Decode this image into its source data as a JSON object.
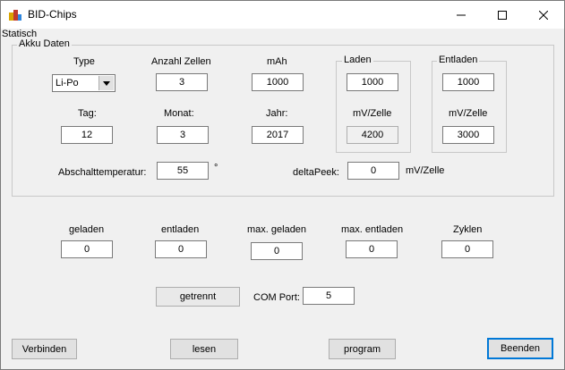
{
  "window": {
    "title": "BID-Chips"
  },
  "menu": {
    "static_label": "Statisch"
  },
  "akku": {
    "group_title": "Akku Daten",
    "type_label": "Type",
    "type_value": "Li-Po",
    "zellen_label": "Anzahl Zellen",
    "zellen_value": "3",
    "mah_label": "mAh",
    "mah_value": "1000",
    "tag_label": "Tag:",
    "tag_value": "12",
    "monat_label": "Monat:",
    "monat_value": "3",
    "jahr_label": "Jahr:",
    "jahr_value": "2017",
    "laden": {
      "group_title": "Laden",
      "value": "1000",
      "mv_label": "mV/Zelle",
      "mv_value": "4200"
    },
    "entladen": {
      "group_title": "Entladen",
      "value": "1000",
      "mv_label": "mV/Zelle",
      "mv_value": "3000"
    },
    "abschalt_label": "Abschalttemperatur:",
    "abschalt_value": "55",
    "abschalt_unit": "°",
    "delta_label": "deltaPeek:",
    "delta_value": "0",
    "delta_unit": "mV/Zelle"
  },
  "stats": {
    "geladen_label": "geladen",
    "geladen_value": "0",
    "entladen_label": "entladen",
    "entladen_value": "0",
    "max_geladen_label": "max. geladen",
    "max_geladen_value": "0",
    "max_entladen_label": "max. entladen",
    "max_entladen_value": "0",
    "zyklen_label": "Zyklen",
    "zyklen_value": "0"
  },
  "connection": {
    "status": "getrennt",
    "com_label": "COM Port:",
    "com_value": "5"
  },
  "buttons": {
    "verbinden": "Verbinden",
    "lesen": "lesen",
    "program": "program",
    "beenden": "Beenden"
  },
  "colors": {
    "accent": "#0078d7"
  }
}
